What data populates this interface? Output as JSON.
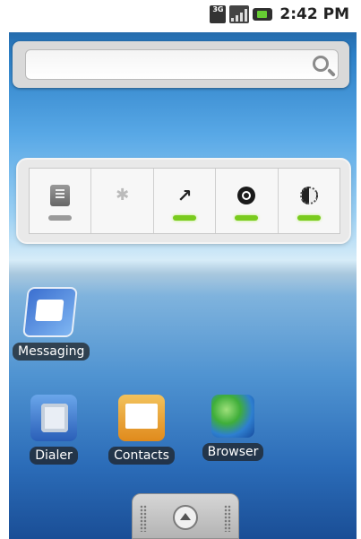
{
  "status_bar": {
    "network_type": "3G",
    "time": "2:42 PM",
    "icons": [
      "3g-icon",
      "signal-icon",
      "battery-icon"
    ]
  },
  "search_widget": {
    "placeholder": "",
    "icon": "search-icon"
  },
  "power_control": {
    "toggles": [
      {
        "name": "wifi",
        "icon": "wifi-icon",
        "state": "off"
      },
      {
        "name": "bluetooth",
        "icon": "bluetooth-icon",
        "state": "off"
      },
      {
        "name": "gps",
        "icon": "gps-icon",
        "state": "on"
      },
      {
        "name": "sync",
        "icon": "sync-icon",
        "state": "on"
      },
      {
        "name": "brightness",
        "icon": "brightness-icon",
        "state": "on"
      }
    ],
    "on_color": "#7acb1e",
    "off_color": "#9a9a9a"
  },
  "apps": {
    "messaging": "Messaging",
    "dialer": "Dialer",
    "contacts": "Contacts",
    "browser": "Browser"
  },
  "drawer": {
    "icon": "app-drawer-icon"
  }
}
